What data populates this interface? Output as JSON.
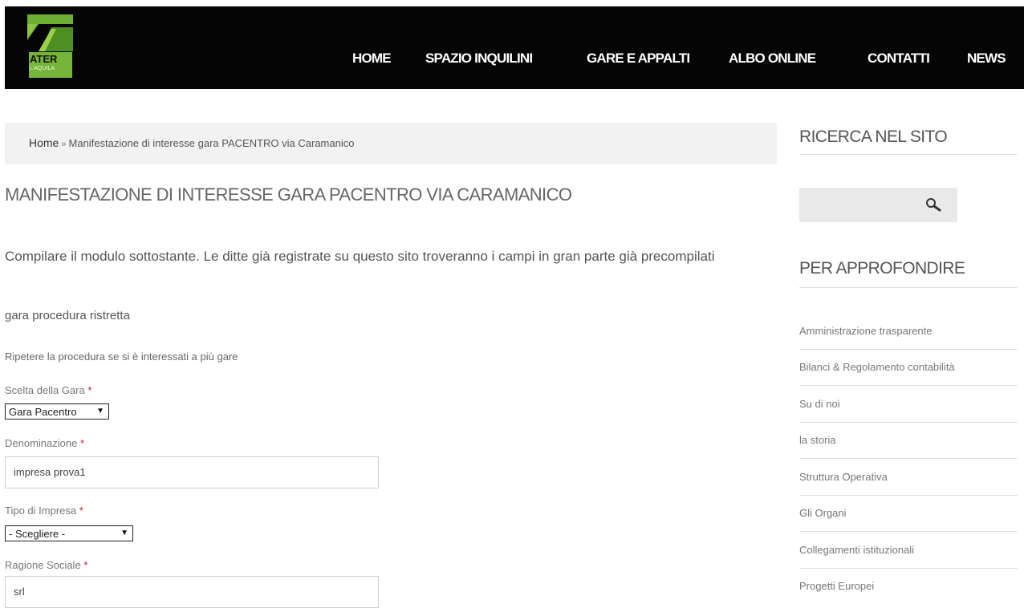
{
  "header": {
    "logo": {
      "word": "ATER",
      "city": "L'AQUILA",
      "color_green": "#76b43a"
    },
    "nav": [
      {
        "label": "HOME"
      },
      {
        "label": "SPAZIO INQUILINI"
      },
      {
        "label": "GARE E APPALTI"
      },
      {
        "label": "ALBO ONLINE"
      },
      {
        "label": "CONTATTI"
      },
      {
        "label": "NEWS"
      }
    ]
  },
  "breadcrumb": {
    "home": "Home",
    "separator": "»",
    "current": "Manifestazione di interesse gara PACENTRO via Caramanico"
  },
  "main": {
    "title": "MANIFESTAZIONE DI INTERESSE GARA PACENTRO VIA CARAMANICO",
    "intro": "Compilare il modulo sottostante. Le ditte già registrate su questo sito troveranno i campi in gran parte già precompilati",
    "subtitle": "gara procedura ristretta",
    "note": "Ripetere la procedura se si è interessati a più gare",
    "form": {
      "required_mark": "*",
      "gara": {
        "label": "Scelta della Gara",
        "value": "Gara Pacentro"
      },
      "denominazione": {
        "label": "Denominazione",
        "value": "impresa prova1"
      },
      "tipo": {
        "label": "Tipo di Impresa",
        "value": "- Scegliere -"
      },
      "ragione": {
        "label": "Ragione Sociale",
        "value": "srl"
      }
    }
  },
  "sidebar": {
    "search_title": "RICERCA NEL SITO",
    "links_title": "PER APPROFONDIRE",
    "links": [
      "Amministrazione trasparente",
      "Bilanci & Regolamento contabilità",
      "Su di noi",
      "la storia",
      "Struttura Operativa",
      "Gli Organi",
      "Collegamenti istituzionali",
      "Progetti Europei"
    ]
  },
  "icons": {
    "search": "search-icon",
    "dropdown": "chevron-down-icon"
  }
}
